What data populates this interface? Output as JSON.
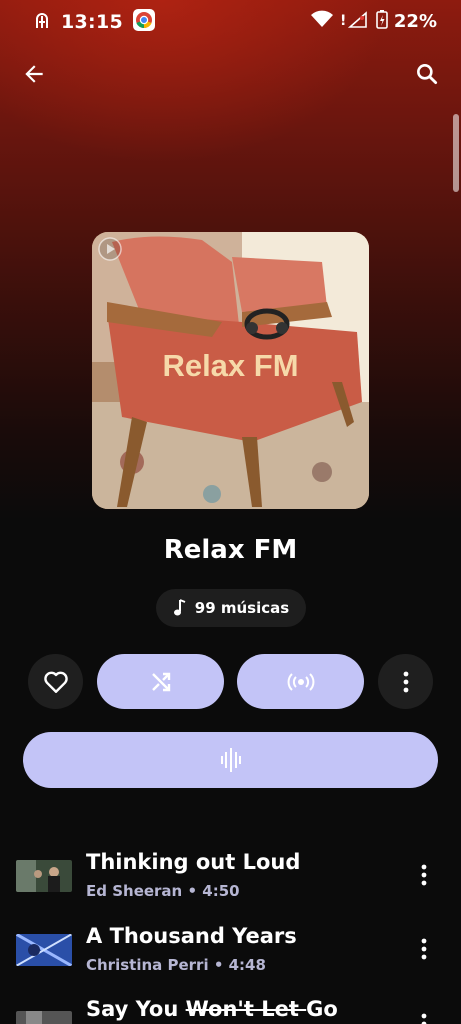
{
  "status_bar": {
    "time": "13:15",
    "battery": "22%",
    "icons": [
      "accessibility-icon",
      "chrome-icon",
      "wifi-icon",
      "signal-icon",
      "battery-charging-icon"
    ]
  },
  "header": {
    "back_icon": "arrow-back-icon",
    "search_icon": "search-icon"
  },
  "playlist": {
    "cover_text": "Relax FM",
    "title": "Relax FM",
    "song_count": "99 músicas"
  },
  "actions": {
    "like_icon": "heart-outline-icon",
    "shuffle_icon": "shuffle-icon",
    "radio_icon": "radio-broadcast-icon",
    "more_icon": "more-vertical-icon",
    "play_icon": "waveform-play-icon"
  },
  "colors": {
    "accent": "#c3c4f7",
    "subtitle": "#b6b6d3",
    "background": "#0b0b0b",
    "header_gradient": "#8e1b0f"
  },
  "tracks": [
    {
      "title": "Thinking out Loud",
      "artist": "Ed Sheeran",
      "duration": "4:50",
      "subtitle": "Ed Sheeran • 4:50"
    },
    {
      "title": "A Thousand Years",
      "artist": "Christina Perri",
      "duration": "4:48",
      "subtitle": "Christina Perri • 4:48"
    },
    {
      "title_part1": "Say You ",
      "title_part2": "Won't Let ",
      "title_part3": "Go"
    }
  ]
}
